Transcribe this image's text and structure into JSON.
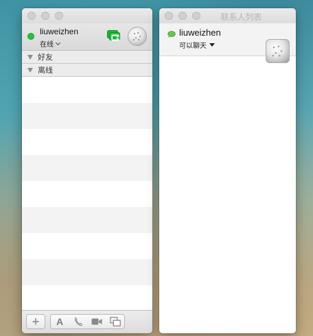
{
  "buddy_list": {
    "account": {
      "name": "liuweizhen",
      "status": "在线",
      "status_color": "#2bc140"
    },
    "groups": [
      {
        "label": "好友"
      },
      {
        "label": "离线"
      }
    ],
    "toolbar": {
      "add_label": "+",
      "text_label": "A"
    }
  },
  "contact_list": {
    "title": "联系人列表",
    "account": {
      "name": "liuweizhen",
      "status": "可以聊天",
      "status_color": "#6cc14a"
    }
  },
  "icons": {
    "video": "video-chat-icon",
    "audio": "phone-icon",
    "camera": "camera-icon",
    "screen": "screen-share-icon"
  }
}
